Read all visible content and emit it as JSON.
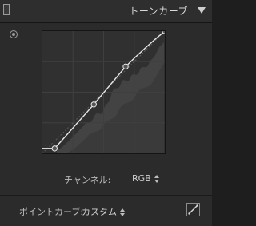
{
  "panel": {
    "title": "トーンカーブ",
    "icons": {
      "collapse": "collapse-box-icon",
      "menu": "triangle-down-icon",
      "target": "target-adjust-icon",
      "curve": "curve-edit-icon"
    }
  },
  "graph": {
    "curve_points": [
      [
        0.1,
        0.04
      ],
      [
        0.42,
        0.4
      ],
      [
        0.68,
        0.71
      ],
      [
        1.0,
        1.0
      ]
    ],
    "curve_color": "#e6e6e6",
    "grid_color": "#3f3f3f",
    "histogram_color": "#4a4a4a"
  },
  "channel": {
    "label": "チャンネル:",
    "value": "RGB"
  },
  "point_curve": {
    "label": "ポイントカーブ:",
    "value": "カスタム"
  }
}
